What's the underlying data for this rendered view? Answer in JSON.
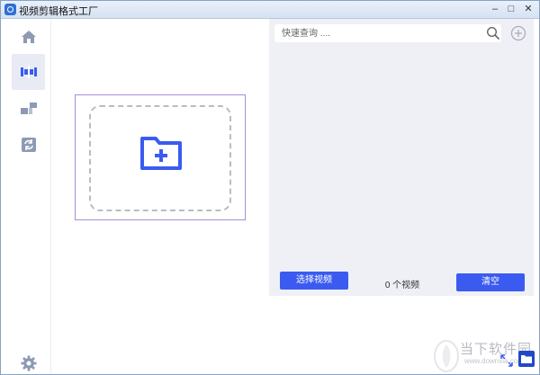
{
  "window": {
    "title": "视频剪辑格式工厂",
    "minimize_glyph": "–",
    "maximize_glyph": "□",
    "close_glyph": "✕"
  },
  "sidebar": {
    "items": [
      {
        "name": "home",
        "icon": "home-icon",
        "active": false
      },
      {
        "name": "video-cut",
        "icon": "film-cut-icon",
        "active": true
      },
      {
        "name": "blocks",
        "icon": "blocks-icon",
        "active": false
      },
      {
        "name": "convert",
        "icon": "refresh-icon",
        "active": false
      }
    ],
    "settings_icon": "gear-icon"
  },
  "dropzone": {
    "icon": "folder-add-icon"
  },
  "panel": {
    "search_placeholder": "快速查询 ....",
    "select_video_label": "选择视频",
    "count_text": "0 个视频",
    "clear_label": "清空"
  },
  "watermark": {
    "brand": "当下软件园",
    "url": "www.downxia.com"
  },
  "colors": {
    "accent": "#3b5bf0",
    "panel_bg": "#eef0f6",
    "card_border": "#a98cdc"
  }
}
